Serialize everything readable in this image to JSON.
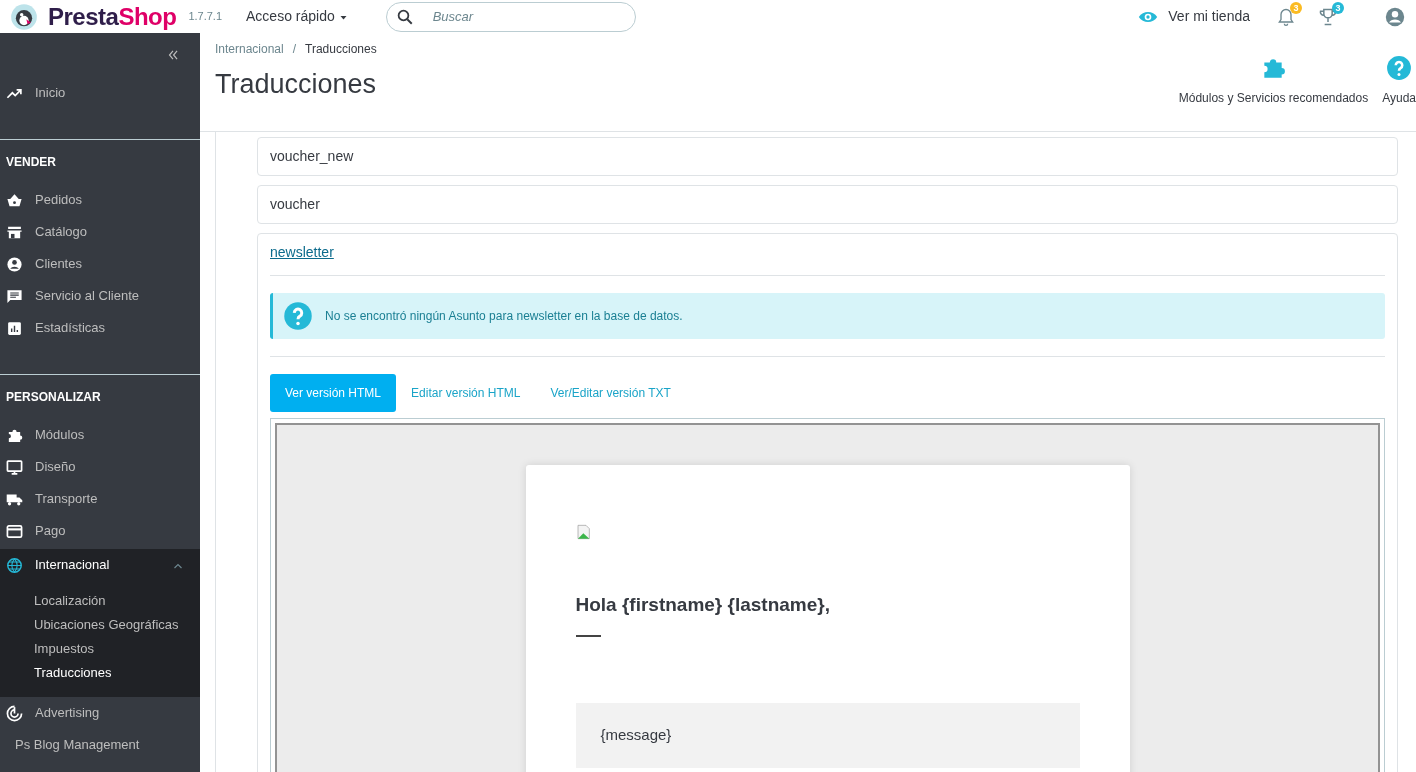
{
  "header": {
    "logo_parts": [
      {
        "text": "Presta",
        "color": "#2f1e4a"
      },
      {
        "text": "Shop",
        "color": "#df0067"
      }
    ],
    "version": "1.7.7.1",
    "quick_access": "Acceso rápido",
    "search": {
      "placeholder": "Buscar"
    },
    "view_shop": "Ver mi tienda",
    "alerts": [
      {
        "kind": "bell",
        "badge": "3",
        "color": "#fbbb22"
      },
      {
        "kind": "trophy",
        "badge": "3",
        "color": "#25b9d7"
      }
    ]
  },
  "sidebar": {
    "items": [
      {
        "kind": "trend",
        "label": "Inicio",
        "selected": false
      },
      {
        "kind": "section",
        "label": "VENDER"
      },
      {
        "kind": "basket",
        "label": "Pedidos",
        "selected": false
      },
      {
        "kind": "store",
        "label": "Catálogo",
        "selected": false
      },
      {
        "kind": "person",
        "label": "Clientes",
        "selected": false
      },
      {
        "kind": "chat",
        "label": "Servicio al Cliente",
        "selected": false
      },
      {
        "kind": "chart",
        "label": "Estadísticas",
        "selected": false
      },
      {
        "kind": "section",
        "label": "PERSONALIZAR"
      },
      {
        "kind": "puzzle",
        "label": "Módulos",
        "selected": false
      },
      {
        "kind": "monitor",
        "label": "Diseño",
        "selected": false
      },
      {
        "kind": "truck",
        "label": "Transporte",
        "selected": false
      },
      {
        "kind": "card",
        "label": "Pago",
        "selected": false
      },
      {
        "kind": "globe",
        "label": "Internacional",
        "selected": true,
        "expanded": true,
        "children": [
          {
            "label": "Localización",
            "selected": false
          },
          {
            "label": "Ubicaciones Geográficas",
            "selected": false
          },
          {
            "label": "Impuestos",
            "selected": false
          },
          {
            "label": "Traducciones",
            "selected": true
          }
        ]
      },
      {
        "kind": "target",
        "label": "Advertising",
        "selected": false
      },
      {
        "kind": "plain",
        "label": "Ps Blog Management",
        "selected": false
      }
    ]
  },
  "page": {
    "breadcrumb": [
      "Internacional",
      "Traducciones"
    ],
    "breadcrumb_separator": "/",
    "title": "Traducciones",
    "toolbar": [
      {
        "kind": "puzzle",
        "label": "Módulos y Servicios recomendados"
      },
      {
        "kind": "help",
        "label": "Ayuda"
      }
    ]
  },
  "templates": {
    "collapsed": [
      "voucher_new",
      "voucher"
    ],
    "open": {
      "name": "newsletter",
      "alert": "No se encontró ningún Asunto para newsletter en la base de datos.",
      "tabs": [
        {
          "label": "Ver versión HTML",
          "selected": true
        },
        {
          "label": "Editar versión HTML",
          "selected": false
        },
        {
          "label": "Ver/Editar versión TXT",
          "selected": false
        }
      ],
      "preview": {
        "greeting": "Hola {firstname} {lastname},",
        "message": "{message}"
      }
    }
  }
}
